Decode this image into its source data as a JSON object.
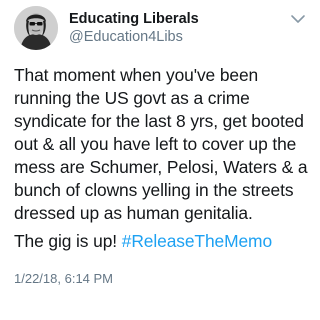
{
  "tweet": {
    "author": {
      "display_name": "Educating Liberals",
      "handle": "@Education4Libs",
      "avatar_icon": "profile-avatar-icon"
    },
    "menu_icon": "chevron-down-icon",
    "text_lines": [
      "That moment when you've been",
      "running the US govt as a crime",
      "syndicate for the last 8 yrs, get booted",
      "out & all you have left to cover up the",
      "mess are Schumer, Pelosi, Waters & a",
      "bunch of clowns yelling in the streets",
      "dressed up as human genitalia."
    ],
    "tagline": "The gig is up! ",
    "hashtag": "#ReleaseTheMemo",
    "timestamp": "1/22/18, 6:14 PM"
  },
  "colors": {
    "text": "#14171a",
    "secondary": "#657786",
    "link": "#1da1f2"
  }
}
